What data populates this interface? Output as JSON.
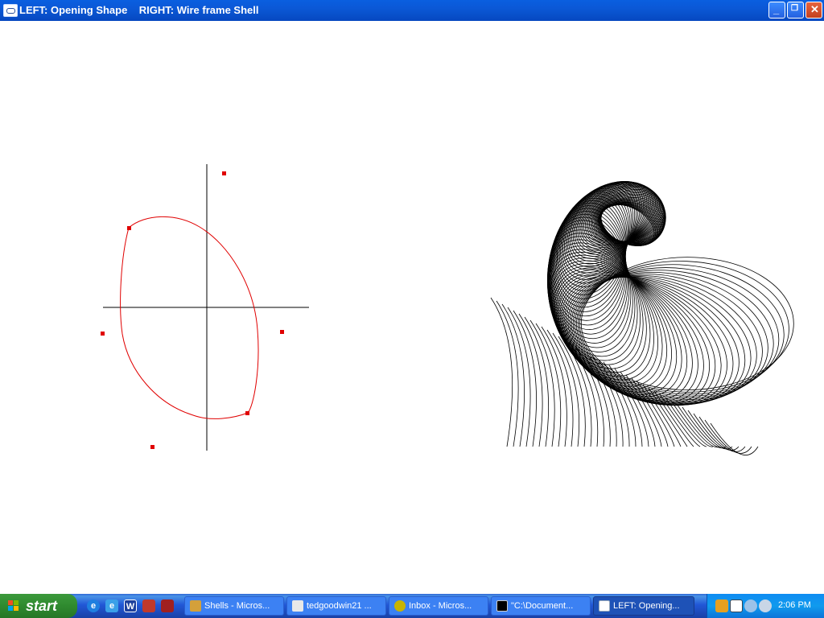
{
  "window": {
    "title": "LEFT: Opening Shape    RIGHT: Wire frame Shell",
    "minimize_icon": "minimize-icon",
    "restore_icon": "restore-icon",
    "close_icon": "close-icon"
  },
  "colors": {
    "curve": "#e00000",
    "axis": "#000000",
    "wire": "#000000",
    "titlebar": "#0a5fe0"
  },
  "taskbar": {
    "start_label": "start",
    "quick_launch": [
      "internet-explorer-icon",
      "outlook-express-icon",
      "word-icon",
      "app-icon",
      "app2-icon"
    ],
    "tasks": [
      {
        "label": "Shells - Micros...",
        "icon": "shells-icon",
        "active": false
      },
      {
        "label": "tedgoodwin21 ...",
        "icon": "messenger-icon",
        "active": false
      },
      {
        "label": "Inbox - Micros...",
        "icon": "outlook-icon",
        "active": false
      },
      {
        "label": "\"C:\\Document...",
        "icon": "cmd-icon",
        "active": false
      },
      {
        "label": "LEFT: Opening...",
        "icon": "window-icon",
        "active": true
      }
    ],
    "tray_icons": [
      "tray-person-icon",
      "tray-calendar-icon",
      "tray-network-icon",
      "tray-speaker-icon"
    ],
    "clock": "2:06 PM"
  }
}
